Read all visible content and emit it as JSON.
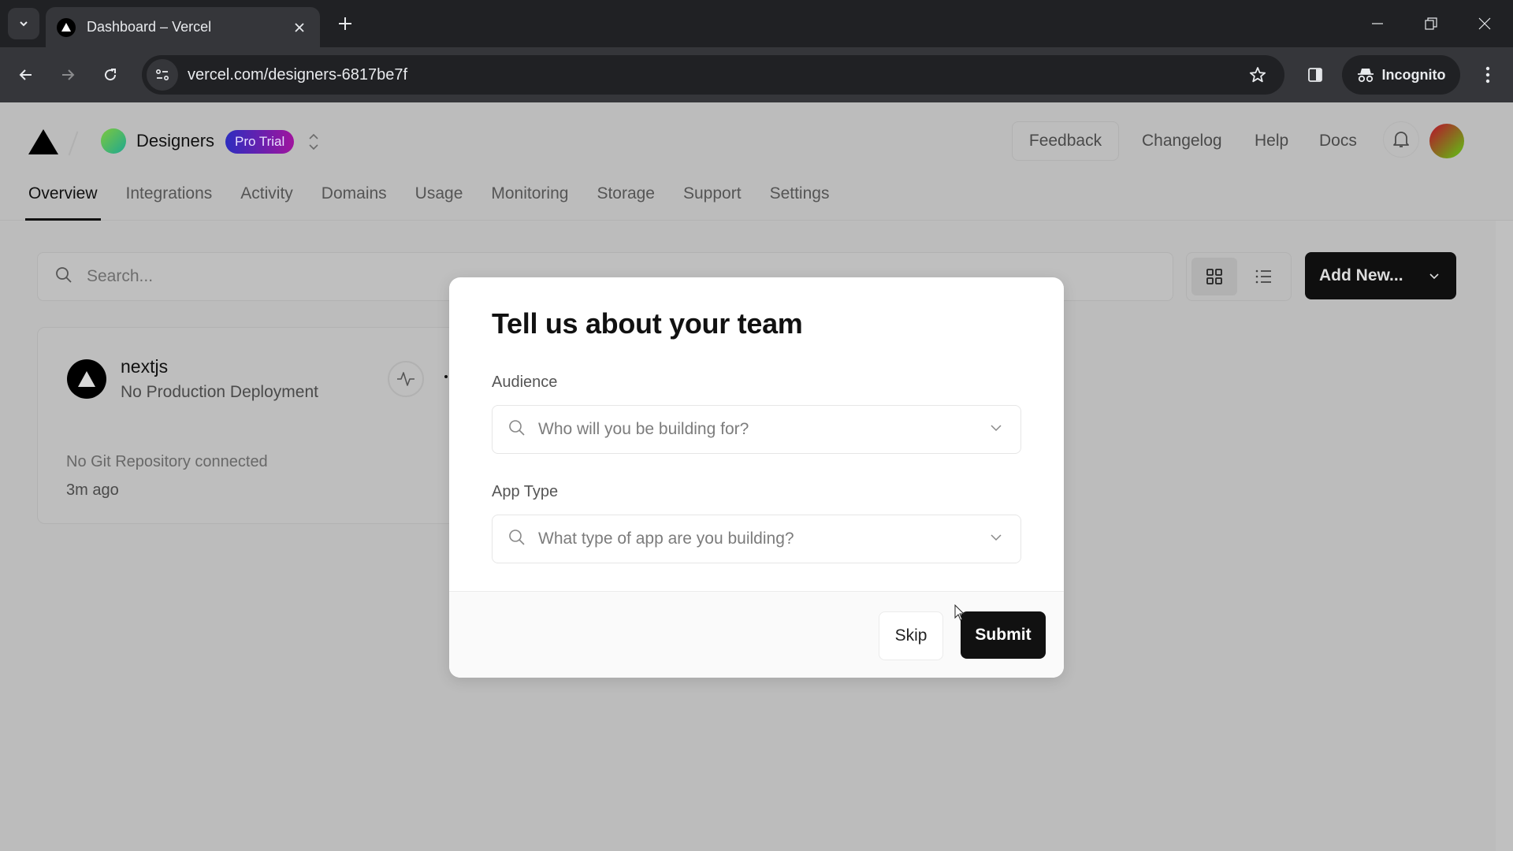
{
  "browser": {
    "tab_title": "Dashboard – Vercel",
    "url": "vercel.com/designers-6817be7f",
    "incognito_label": "Incognito"
  },
  "header": {
    "team_name": "Designers",
    "plan_badge": "Pro Trial",
    "links": {
      "feedback": "Feedback",
      "changelog": "Changelog",
      "help": "Help",
      "docs": "Docs"
    }
  },
  "nav": {
    "tabs": [
      {
        "label": "Overview",
        "active": true
      },
      {
        "label": "Integrations"
      },
      {
        "label": "Activity"
      },
      {
        "label": "Domains"
      },
      {
        "label": "Usage"
      },
      {
        "label": "Monitoring"
      },
      {
        "label": "Storage"
      },
      {
        "label": "Support"
      },
      {
        "label": "Settings"
      }
    ]
  },
  "toolbar": {
    "search_placeholder": "Search...",
    "add_new_label": "Add New..."
  },
  "project": {
    "name": "nextjs",
    "status": "No Production Deployment",
    "repo": "No Git Repository connected",
    "updated": "3m ago"
  },
  "modal": {
    "title": "Tell us about your team",
    "audience_label": "Audience",
    "audience_placeholder": "Who will you be building for?",
    "app_type_label": "App Type",
    "app_type_placeholder": "What type of app are you building?",
    "skip_label": "Skip",
    "submit_label": "Submit"
  },
  "colors": {
    "badge_start": "#2d2dbf",
    "badge_end": "#a0149e",
    "primary_button": "#111111"
  }
}
